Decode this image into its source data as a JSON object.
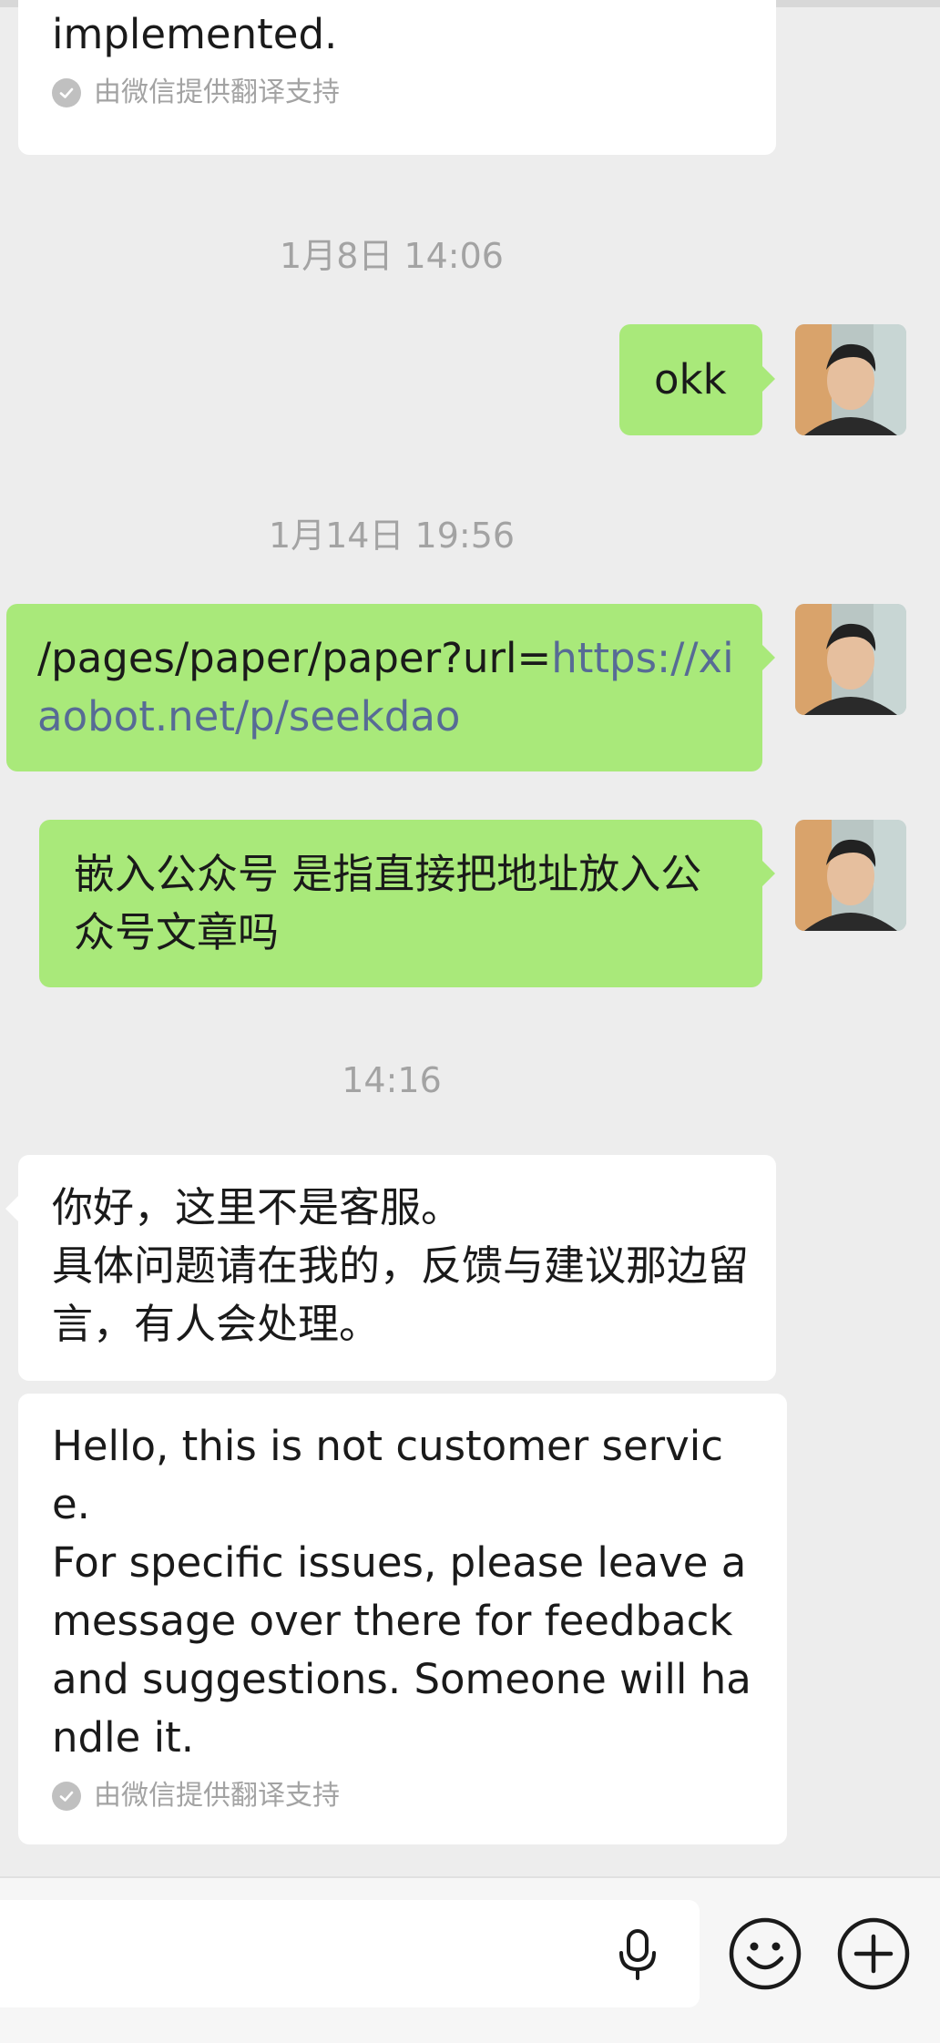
{
  "messages": {
    "m1": {
      "text": "implemented.",
      "translation_note": "由微信提供翻译支持"
    },
    "t1": "1月8日 14:06",
    "m2": {
      "text": "okk"
    },
    "t2": "1月14日 19:56",
    "m3": {
      "text_prefix": "/pages/paper/paper?url=",
      "text_link": "https://xiaobot.net/p/seekdao"
    },
    "m4": {
      "text": "嵌入公众号 是指直接把地址放入公众号文章吗"
    },
    "t3": "14:16",
    "m5": {
      "text": "你好，这里不是客服。\n具体问题请在我的，反馈与建议那边留言，有人会处理。"
    },
    "m6": {
      "text": "Hello, this is not customer service.\nFor specific issues, please leave a message over there for feedback and suggestions. Someone will handle it.",
      "translation_note": "由微信提供翻译支持"
    }
  },
  "icons": {
    "check": "check-circle-icon",
    "mic": "microphone-icon",
    "emoji": "emoji-face-icon",
    "plus": "plus-circle-icon",
    "avatar": "user-avatar"
  },
  "colors": {
    "background": "#ededed",
    "outgoing_bubble": "#a9e97a",
    "incoming_bubble": "#ffffff",
    "link": "#576b95",
    "meta_text": "#a3a3a3"
  }
}
